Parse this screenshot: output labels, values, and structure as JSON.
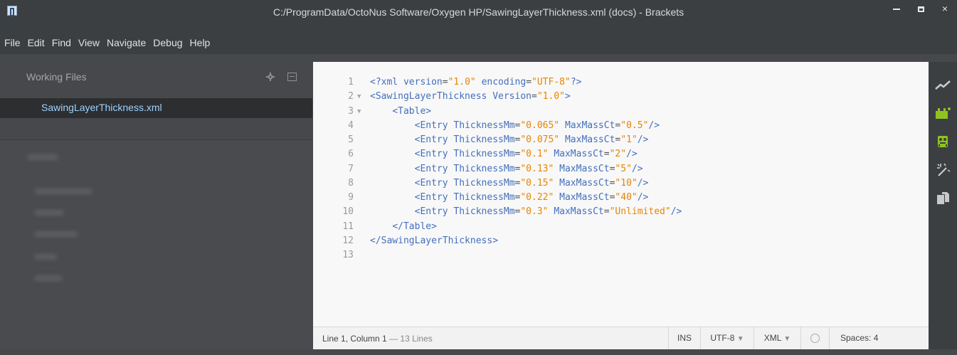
{
  "window": {
    "title": "C:/ProgramData/OctoNus Software/Oxygen HP/SawingLayerThickness.xml (docs) - Brackets",
    "controls": {
      "minimize": "",
      "maximize": "",
      "close": "×"
    }
  },
  "menu": {
    "items": [
      "File",
      "Edit",
      "Find",
      "View",
      "Navigate",
      "Debug",
      "Help"
    ]
  },
  "sidebar": {
    "working_files_title": "Working Files",
    "active_file": "SawingLayerThickness.xml"
  },
  "editor": {
    "line_numbers": [
      "1",
      "2",
      "3",
      "4",
      "5",
      "6",
      "7",
      "8",
      "9",
      "10",
      "11",
      "12",
      "13"
    ],
    "fold_markers": [
      "",
      "▼",
      "▼",
      "",
      "",
      "",
      "",
      "",
      "",
      "",
      "",
      "",
      ""
    ],
    "lines": [
      {
        "t": "<?xml version=\"1.0\" encoding=\"UTF-8\"?>"
      },
      {
        "t": "<SawingLayerThickness Version=\"1.0\">"
      },
      {
        "t": "    <Table>"
      },
      {
        "t": "        <Entry ThicknessMm=\"0.065\" MaxMassCt=\"0.5\"/>"
      },
      {
        "t": "        <Entry ThicknessMm=\"0.075\" MaxMassCt=\"1\"/>"
      },
      {
        "t": "        <Entry ThicknessMm=\"0.1\" MaxMassCt=\"2\"/>"
      },
      {
        "t": "        <Entry ThicknessMm=\"0.13\" MaxMassCt=\"5\"/>"
      },
      {
        "t": "        <Entry ThicknessMm=\"0.15\" MaxMassCt=\"10\"/>"
      },
      {
        "t": "        <Entry ThicknessMm=\"0.22\" MaxMassCt=\"40\"/>"
      },
      {
        "t": "        <Entry ThicknessMm=\"0.3\" MaxMassCt=\"Unlimited\"/>"
      },
      {
        "t": "    </Table>"
      },
      {
        "t": "</SawingLayerThickness>"
      },
      {
        "t": ""
      }
    ]
  },
  "statusbar": {
    "position": "Line 1, Column 1",
    "line_count": "— 13 Lines",
    "mode": "INS",
    "encoding": "UTF-8",
    "language": "XML",
    "spaces": "Spaces: 4",
    "caret": "▼"
  },
  "toolbar": {
    "icons": [
      "live-preview-icon",
      "extension-manager-icon",
      "extension-icon",
      "magic-wand-icon",
      "copy-icon"
    ]
  },
  "colors": {
    "accent_file": "#9dd2ff",
    "xml_tag": "#446fbd",
    "xml_value": "#e88501",
    "toolbar_green": "#8fc31f"
  }
}
